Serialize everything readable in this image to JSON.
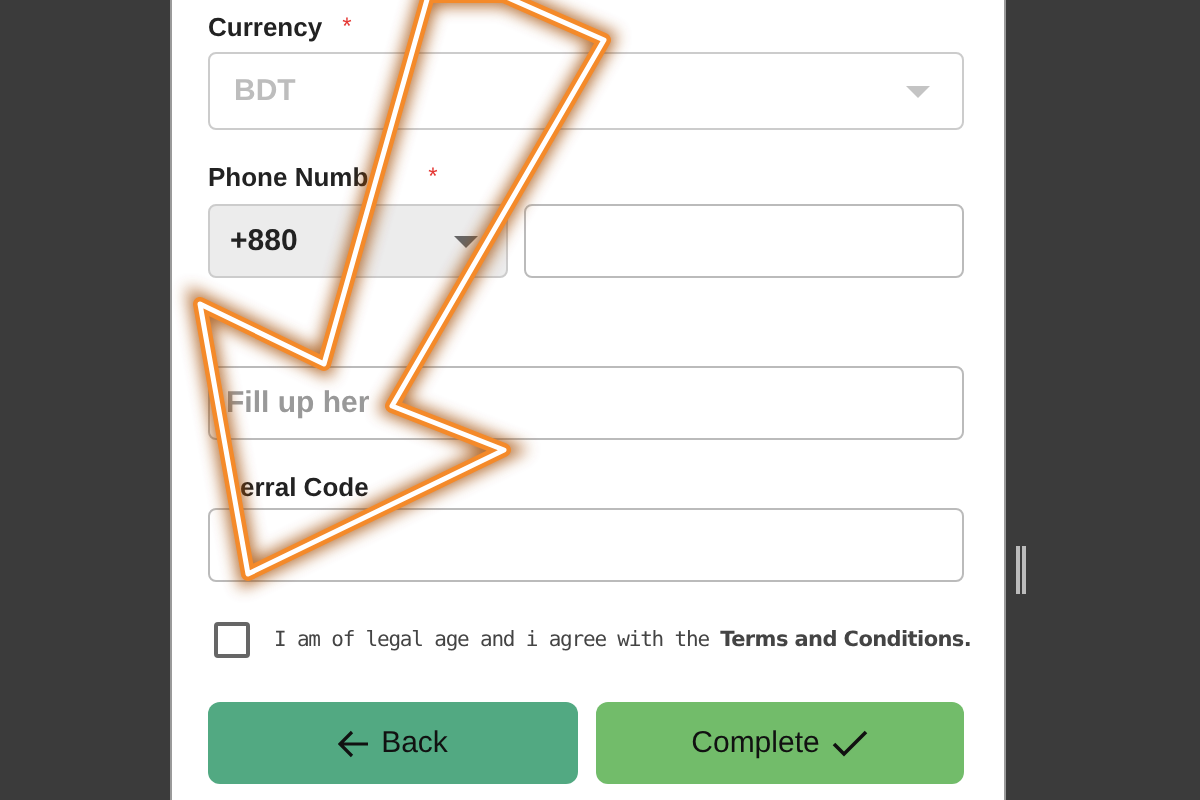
{
  "currency": {
    "label": "Currency",
    "required_mark": "*",
    "value": "BDT",
    "disabled": true
  },
  "phone": {
    "label": "Phone Numb",
    "required_mark": "*",
    "code": "+880"
  },
  "name_field": {
    "placeholder": "Fill up her"
  },
  "referral": {
    "label": "erral Code"
  },
  "agreement": {
    "checked": false,
    "text": "I am of legal age and i agree with the **Terms and Conditions.**"
  },
  "buttons": [
    {
      "kind": "back",
      "label": "Back"
    },
    {
      "kind": "complete",
      "label": "Complete"
    }
  ]
}
